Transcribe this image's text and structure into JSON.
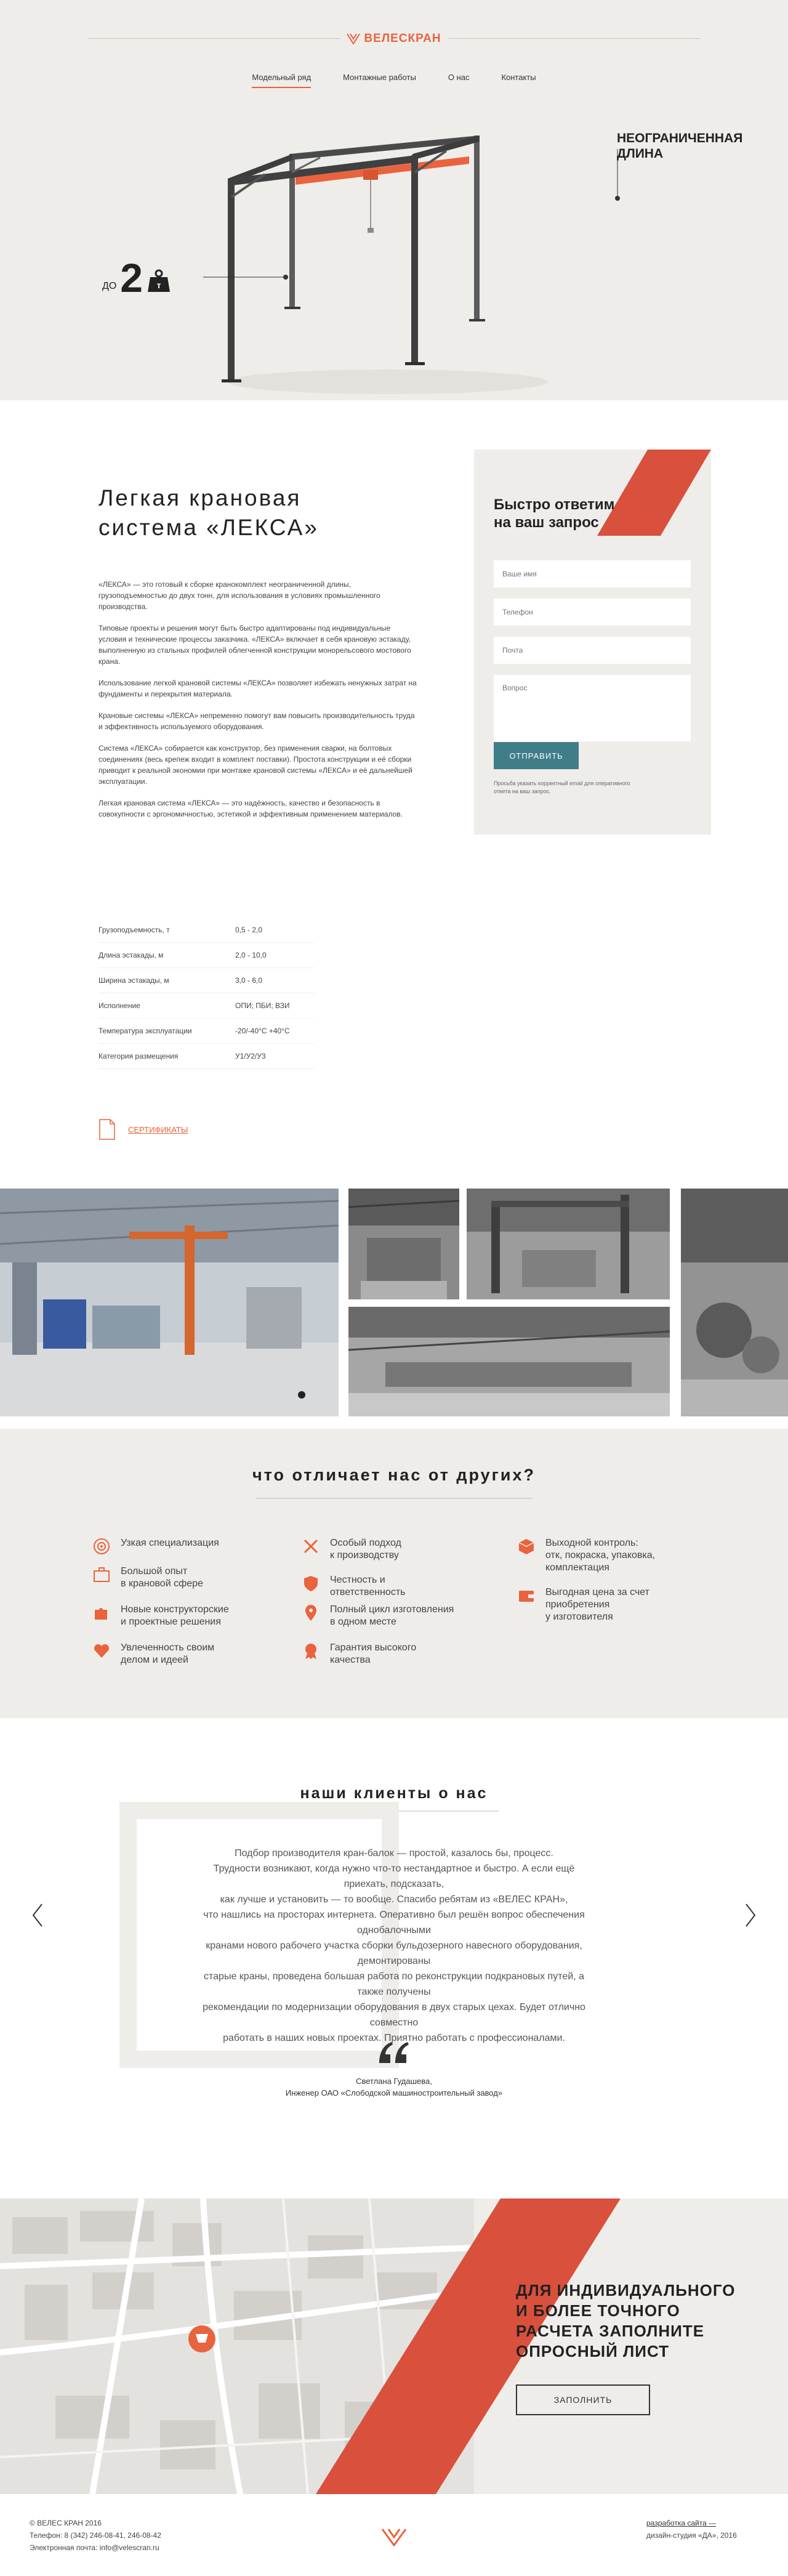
{
  "brand": {
    "name": "ВЕЛЕСКРАН",
    "accent": "#e9633f",
    "teal": "#3f7d88"
  },
  "nav": [
    "Модельный ряд",
    "Монтажные работы",
    "О нас",
    "Контакты"
  ],
  "hero": {
    "callout_length": [
      "НЕОГРАНИЧЕННАЯ",
      "ДЛИНА"
    ],
    "capacity_prefix": "ДО",
    "capacity_value": "2",
    "capacity_unit": "т"
  },
  "product": {
    "title_lines": [
      "Легкая крановая",
      "система «ЛЕКСА»"
    ],
    "paragraphs": [
      "«ЛЕКСА» — это готовый к сборке кранокомплект неограниченной длины, грузоподъемностью до двух тонн, для использования в условиях промышленного производства.",
      "Типовые проекты и решения могут быть быстро адаптированы под индивидуальные условия и технические процессы заказчика. «ЛЕКСА» включает в себя крановую эстакаду, выполненную из стальных профилей облегченной конструкции монорельсового мостового крана.",
      "Использование легкой крановой системы «ЛЕКСА» позволяет избежать ненужных затрат на фундаменты и перекрытия материала.",
      "Крановые системы «ЛЕКСА» непременно помогут вам повысить производительность труда и эффективность используемого оборудования.",
      "Система «ЛЕКСА» собирается как конструктор, без применения сварки, на болтовых соединениях (весь крепеж входит в комплект поставки). Простота конструкции и её сборки приводит к реальной экономии при монтаже крановой системы «ЛЕКСА» и её дальнейшей эксплуатации.",
      "Легкая крановая система «ЛЕКСА» — это надёжность, качество и безопасность в совокупности с эргономичностью, эстетикой и эффективным применением материалов."
    ],
    "specs": [
      {
        "name": "Грузоподъемность, т",
        "value": "0,5 - 2,0"
      },
      {
        "name": "Длина эстакады, м",
        "value": "2,0 - 10,0"
      },
      {
        "name": "Ширина эстакады, м",
        "value": "3,0 - 6,0"
      },
      {
        "name": "Исполнение",
        "value": "ОПИ; ПБИ; ВЗИ"
      },
      {
        "name": "Температура эксплуатации",
        "value": "-20/-40°С +40°С"
      },
      {
        "name": "Категория размещения",
        "value": "У1/У2/У3"
      }
    ],
    "certificates_label": "СЕРТИФИКАТЫ"
  },
  "form": {
    "title_lines": [
      "Быстро ответим",
      "на ваш запрос"
    ],
    "name_placeholder": "Ваше имя",
    "phone_placeholder": "Телефон",
    "email_placeholder": "Почта",
    "question_placeholder": "Вопрос",
    "submit_label": "ОТПРАВИТЬ",
    "note": "Просьба указать корректный email для оперативного ответа на ваш запрос."
  },
  "features": {
    "title": "что отличает нас от других?",
    "items": [
      {
        "icon": "target-icon",
        "lines": [
          "Узкая специализация"
        ]
      },
      {
        "icon": "briefcase-icon",
        "lines": [
          "Большой опыт",
          "в крановой сфере"
        ]
      },
      {
        "icon": "puzzle-icon",
        "lines": [
          "Новые конструкторские",
          "и проектные решения"
        ]
      },
      {
        "icon": "heart-icon",
        "lines": [
          "Увлеченность своим",
          "делом и идеей"
        ]
      },
      {
        "icon": "tools-icon",
        "lines": [
          "Особый подход",
          "к производству"
        ]
      },
      {
        "icon": "shield-icon",
        "lines": [
          "Честность и ответственность"
        ]
      },
      {
        "icon": "location-icon",
        "lines": [
          "Полный цикл изготовления",
          "в одном месте"
        ]
      },
      {
        "icon": "badge-icon",
        "lines": [
          "Гарантия высокого",
          "качества"
        ]
      },
      {
        "icon": "box-icon",
        "lines": [
          "Выходной контроль:",
          "отк, покраска, упаковка,",
          "комплектация"
        ]
      },
      {
        "icon": "wallet-icon",
        "lines": [
          "Выгодная цена за счет",
          "приобретения",
          "у изготовителя"
        ]
      }
    ]
  },
  "reviews": {
    "title": "наши клиенты о нас",
    "text_lines": [
      "Подбор производителя кран-балок — простой, казалось бы, процесс.",
      "Трудности возникают, когда нужно что-то нестандартное и быстро. А если ещё приехать, подсказать,",
      "как лучше и установить — то вообще. Спасибо ребятам из «ВЕЛЕС КРАН»,",
      "что нашлись на просторах интернета. Оперативно был решён вопрос обеспечения однобалочными",
      "кранами нового рабочего участка сборки бульдозерного навесного оборудования, демонтированы",
      "старые краны, проведена большая работа по реконструкции подкрановых путей, а также получены",
      "рекомендации по модернизации оборудования в двух старых цехах. Будет отлично совместно",
      "работать в наших новых проектах. Приятно работать с профессионалами."
    ],
    "author": "Светлана Гудашева,",
    "position": "Инженер ОАО «Слободской машиностроительный завод»"
  },
  "cta": {
    "title_lines": [
      "ДЛЯ ИНДИВИДУАЛЬНОГО",
      "И БОЛЕЕ ТОЧНОГО",
      "РАСЧЕТА ЗАПОЛНИТЕ",
      "ОПРОСНЫЙ ЛИСТ"
    ],
    "button_label": "ЗАПОЛНИТЬ"
  },
  "footer": {
    "copyright": "© ВЕЛЕС КРАН 2016",
    "phones": "Телефон: 8 (342) 246-08-41, 246-08-42",
    "email": "Электронная почта: info@velescran.ru",
    "dev_link": "разработка сайта —",
    "dev_studio": "дизайн-студия «ДА», 2016"
  }
}
